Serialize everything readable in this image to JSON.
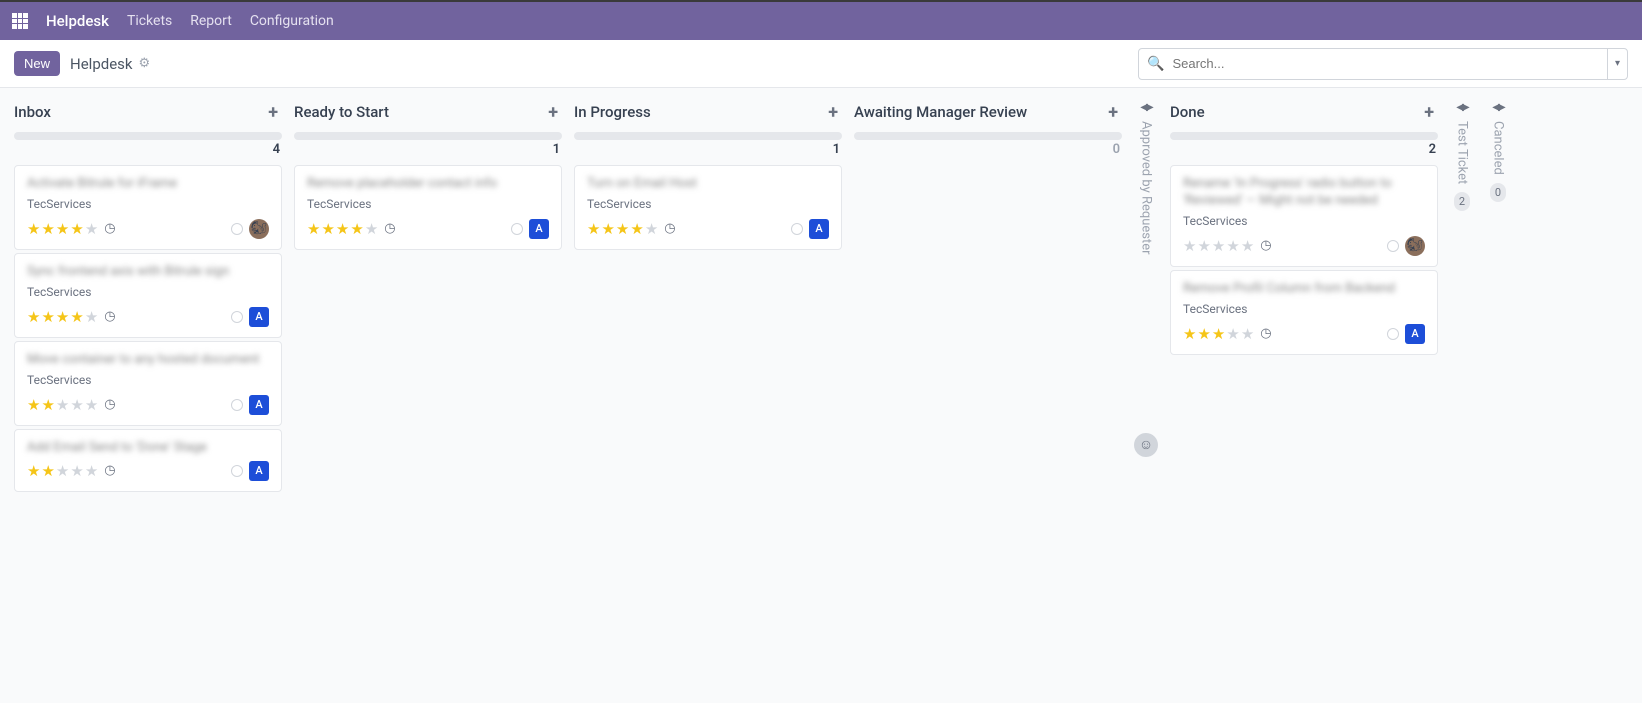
{
  "topbar": {
    "app": "Helpdesk",
    "links": [
      "Tickets",
      "Report",
      "Configuration"
    ]
  },
  "controlbar": {
    "new_btn": "New",
    "breadcrumb": "Helpdesk",
    "search_placeholder": "Search..."
  },
  "columns": [
    {
      "title": "Inbox",
      "count": "4",
      "zero": false,
      "cards": [
        {
          "title": "Activate Bitrule for iFrame",
          "sub": "TecServices",
          "stars": 4,
          "avatar": "img"
        },
        {
          "title": "Sync frontend axis with Bitrule sign",
          "sub": "TecServices",
          "stars": 4,
          "avatar": "A"
        },
        {
          "title": "Move container to any hosted document",
          "sub": "TecServices",
          "stars": 2,
          "avatar": "A"
        },
        {
          "title": "Add Email Send to 'Done' Stage",
          "sub": "",
          "stars": 2,
          "avatar": "A"
        }
      ]
    },
    {
      "title": "Ready to Start",
      "count": "1",
      "zero": false,
      "cards": [
        {
          "title": "Remove placeholder contact info",
          "sub": "TecServices",
          "stars": 4,
          "avatar": "A"
        }
      ]
    },
    {
      "title": "In Progress",
      "count": "1",
      "zero": false,
      "cards": [
        {
          "title": "Turn on Email Host",
          "sub": "TecServices",
          "stars": 4,
          "avatar": "A"
        }
      ]
    },
    {
      "title": "Awaiting Manager Review",
      "count": "0",
      "zero": true,
      "cards": []
    }
  ],
  "folded1": {
    "label": "Approved by Requester"
  },
  "done_col": {
    "title": "Done",
    "count": "2",
    "cards": [
      {
        "title": "Rename 'In Progress' radio button to 'Reviewed' — Might not be needed",
        "sub": "TecServices",
        "stars": 0,
        "avatar": "img"
      },
      {
        "title": "Remove Profil Column from Backend",
        "sub": "TecServices",
        "stars": 3,
        "avatar": "A"
      }
    ]
  },
  "folded2": {
    "label": "Test Ticket",
    "count": "2"
  },
  "folded3": {
    "label": "Canceled",
    "count": "0"
  }
}
